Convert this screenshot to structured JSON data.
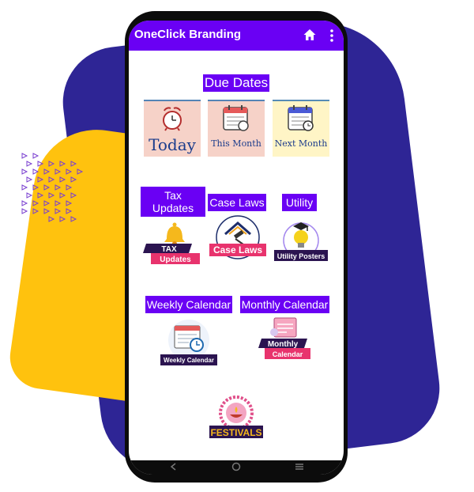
{
  "app": {
    "title": "OneClick Branding"
  },
  "icons": {
    "home": "home-icon",
    "more": "more-vert-icon"
  },
  "sections": {
    "due_dates": {
      "title": "Due Dates",
      "tiles": [
        {
          "label": "Today",
          "icon": "alarm-clock-icon",
          "bg": "#f6d2c8"
        },
        {
          "label": "This Month",
          "icon": "calendar-icon",
          "bg": "#f6d2c8"
        },
        {
          "label": "Next Month",
          "icon": "calendar-clock-icon",
          "bg": "#fff5c6"
        }
      ]
    },
    "tax_updates": {
      "title_line1": "Tax",
      "title_line2": "Updates",
      "badge_line1": "TAX",
      "badge_line2": "Updates",
      "icon": "bell-icon"
    },
    "case_laws": {
      "title": "Case Laws",
      "badge": "Case Laws",
      "icon": "gavel-icon"
    },
    "utility": {
      "title": "Utility",
      "badge": "Utility Posters",
      "icon": "lightbulb-icon"
    },
    "weekly_calendar": {
      "title": "Weekly Calendar",
      "badge": "Weekly Calendar",
      "icon": "calendar-clock-icon"
    },
    "monthly_calendar": {
      "title": "Monthly Calendar",
      "badge_line1": "Monthly",
      "badge_line2": "Calendar",
      "icon": "calendar-icon"
    },
    "festivals": {
      "badge": "FESTIVALS",
      "icon": "diya-lamp-icon"
    }
  },
  "colors": {
    "accent": "#6a00f4",
    "background_purple": "#2e2595",
    "background_yellow": "#ffc20e",
    "badge_pink": "#e8336d",
    "badge_dark": "#2b1450"
  }
}
